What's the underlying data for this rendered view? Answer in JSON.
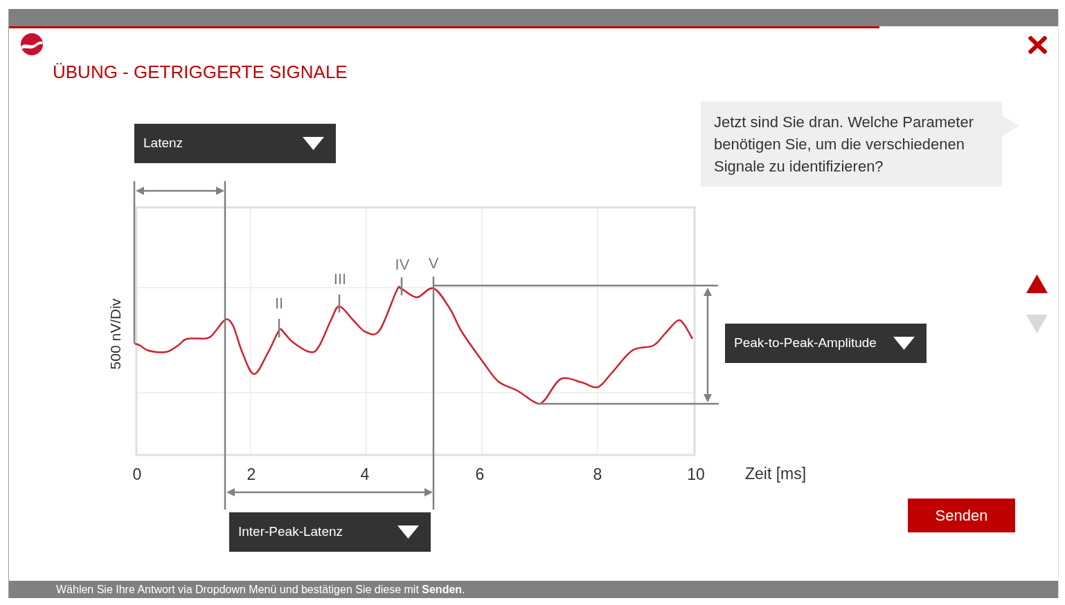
{
  "progress": {
    "level": 0.83
  },
  "title": "ÜBUNG - GETRIGGERTE SIGNALE",
  "instruction": "Jetzt sind Sie dran. Welche Parameter benötigen Sie, um die verschiedenen Signale zu identifizieren?",
  "answer_dropdowns": [
    {
      "value": "Latenz"
    },
    {
      "value": "Peak-to-Peak-Amplitude"
    },
    {
      "value": "Inter-Peak-Latenz"
    }
  ],
  "chart": {
    "y_label": "500 nV/Div",
    "x_label": "Zeit [ms]",
    "x_ticks": [
      "0",
      "2",
      "4",
      "6",
      "8",
      "10"
    ],
    "peak_labels": [
      "II",
      "III",
      "IV",
      "V"
    ]
  },
  "navigation": {
    "up": {
      "disabled": false
    },
    "down": {
      "disabled": true
    }
  },
  "submit_button": {
    "label": "Senden"
  },
  "footer_hint": "Wählen Sie Ihre Antwort via Dropdown Menü und bestätigen Sie diese mit **Senden**."
}
